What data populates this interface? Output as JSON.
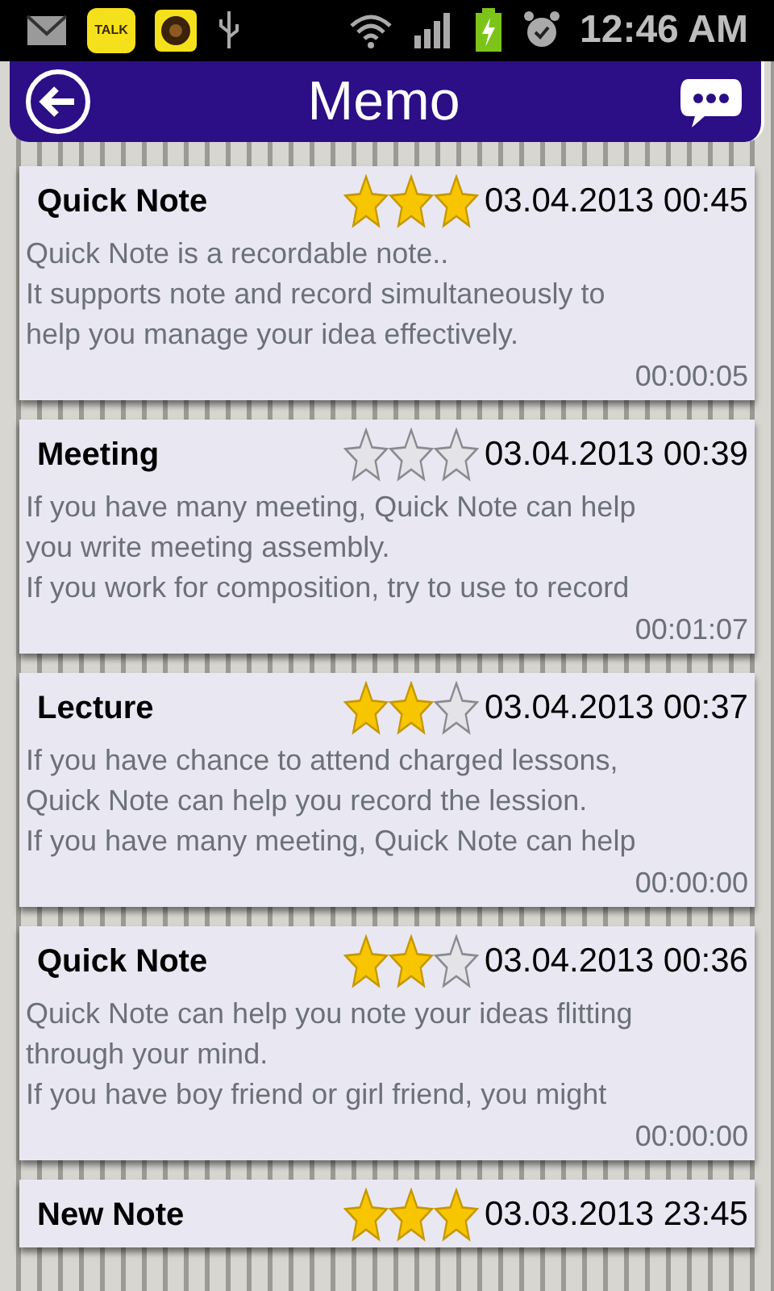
{
  "status_bar": {
    "app_badge": "TALK",
    "time": "12:46 AM"
  },
  "header": {
    "title": "Memo"
  },
  "notes": [
    {
      "title": "Quick Note",
      "stars": 3,
      "date": "03.04.2013 00:45",
      "body": [
        "Quick Note is a recordable note..",
        "It supports note and record simultaneously to",
        "help you manage your idea effectively."
      ],
      "duration": "00:00:05"
    },
    {
      "title": "Meeting",
      "stars": 0,
      "date": "03.04.2013 00:39",
      "body": [
        "If you have many meeting, Quick Note can help",
        "you write meeting assembly.",
        "If you work for composition, try to use to record"
      ],
      "duration": "00:01:07"
    },
    {
      "title": "Lecture",
      "stars": 2,
      "date": "03.04.2013 00:37",
      "body": [
        "If you have chance to attend charged lessons,",
        "Quick Note can help you record the lession.",
        "If you have many meeting, Quick Note can help"
      ],
      "duration": "00:00:00"
    },
    {
      "title": "Quick Note",
      "stars": 2,
      "date": "03.04.2013 00:36",
      "body": [
        "Quick Note can help you note your ideas flitting",
        "through your mind.",
        "If you have boy friend or girl friend, you might"
      ],
      "duration": "00:00:00"
    },
    {
      "title": "New Note",
      "stars": 3,
      "date": "03.03.2013 23:45"
    }
  ]
}
